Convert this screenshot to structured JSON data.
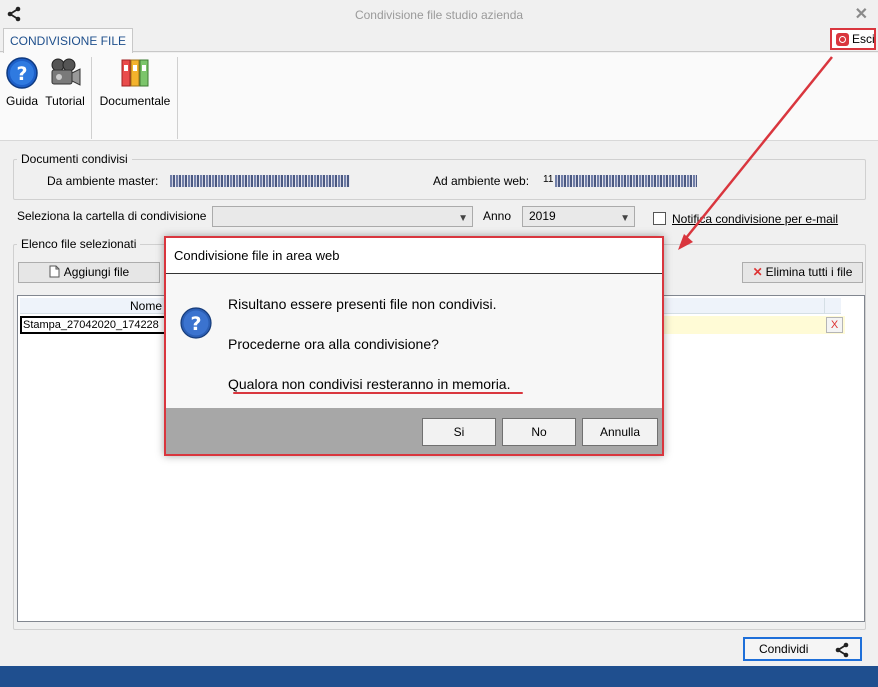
{
  "window": {
    "title": "Condivisione file studio azienda",
    "close_glyph": "✕"
  },
  "ribbon": {
    "tab_label": "CONDIVISIONE FILE",
    "exit_label": "Esci",
    "buttons": [
      {
        "label": "Guida",
        "icon": "help-icon"
      },
      {
        "label": "Tutorial",
        "icon": "video-camera-icon"
      },
      {
        "label": "Documentale",
        "icon": "binders-icon"
      }
    ]
  },
  "shared_docs": {
    "group_title": "Documenti condivisi",
    "master_label": "Da ambiente master:",
    "web_label": "Ad ambiente web:",
    "web_value_prefix": "11"
  },
  "folder": {
    "label": "Seleziona la cartella di condivisione",
    "value": "",
    "year_label": "Anno",
    "year_value": "2019",
    "notify_label": "Notifica condivisione per e-mail",
    "notify_checked": false
  },
  "file_list": {
    "group_title": "Elenco file selezionati",
    "add_label": "Aggiungi file",
    "delete_all_label": "Elimina tutti i file",
    "column_name": "Nome",
    "rows": [
      {
        "name": "Stampa_27042020_174228",
        "delete_glyph": "X"
      }
    ]
  },
  "dialog": {
    "title": "Condivisione file in area web",
    "lines": [
      "Risultano essere presenti file non condivisi.",
      "Procederne ora alla condivisione?",
      "Qualora non condivisi resteranno in memoria."
    ],
    "buttons": {
      "yes": "Si",
      "no": "No",
      "cancel": "Annulla"
    }
  },
  "footer": {
    "share_label": "Condividi"
  },
  "colors": {
    "accent_blue": "#1f4f8f",
    "highlight_red": "#d9363e",
    "row_yellow": "#fffbd6"
  }
}
